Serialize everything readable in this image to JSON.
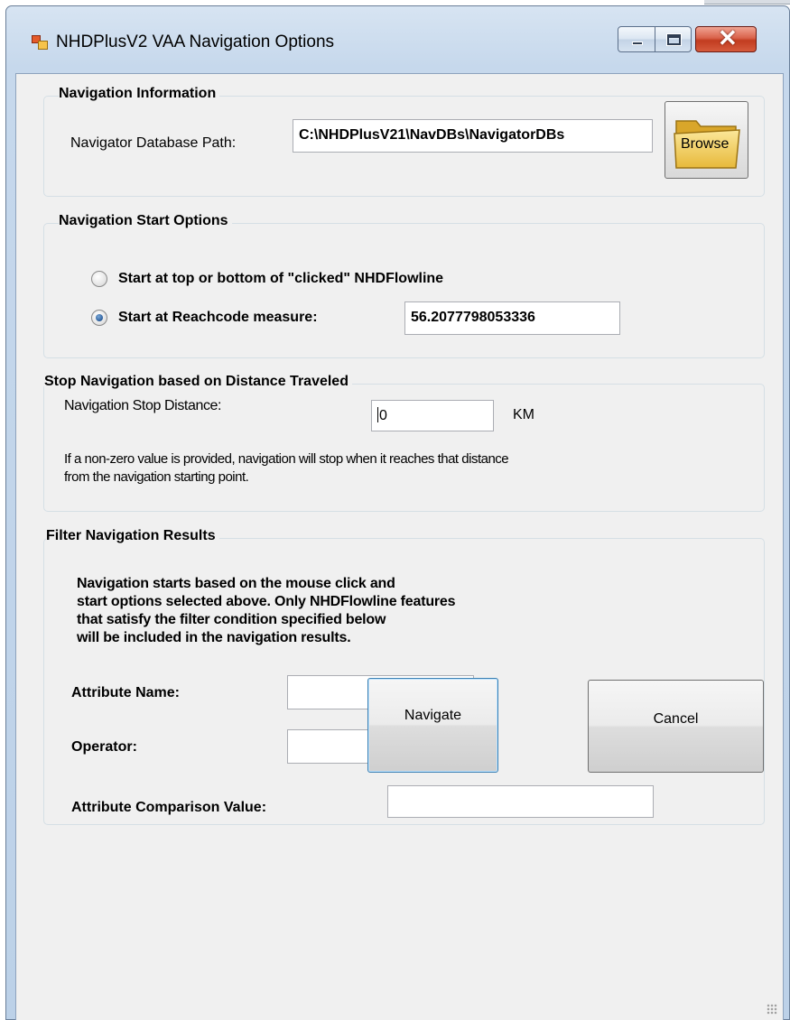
{
  "window": {
    "title": "NHDPlusV2 VAA Navigation Options"
  },
  "navigation_information": {
    "legend": "Navigation Information",
    "path_label": "Navigator Database Path:",
    "path_value": "C:\\NHDPlusV21\\NavDBs\\NavigatorDBs",
    "browse_label": "Browse",
    "browse_icon": "folder-icon"
  },
  "start_options": {
    "legend": "Navigation Start Options",
    "option_top_bottom": {
      "label": "Start at top or bottom of \"clicked\" NHDFlowline",
      "checked": false
    },
    "option_reachcode": {
      "label": "Start at Reachcode measure:",
      "checked": true
    },
    "reachcode_value": "56.2077798053336"
  },
  "stop_distance": {
    "legend": "Stop Navigation based on Distance Traveled",
    "label": "Navigation Stop Distance:",
    "value": "0",
    "unit": "KM",
    "note_line1": "If a non-zero value is provided, navigation will stop when it reaches that distance",
    "note_line2": "from the navigation starting point."
  },
  "filter": {
    "legend": "Filter Navigation Results",
    "desc_line1": "Navigation starts based on the mouse click and",
    "desc_line2": "start options selected above.  Only NHDFlowline features",
    "desc_line3": "that satisfy the filter condition specified below",
    "desc_line4": "will be included in the navigation results.",
    "attribute_name_label": "Attribute Name:",
    "attribute_name_value": "",
    "operator_label": "Operator:",
    "operator_value": "",
    "comparison_label": "Attribute Comparison Value:",
    "comparison_value": ""
  },
  "buttons": {
    "navigate": "Navigate",
    "cancel": "Cancel"
  },
  "colors": {
    "title_gradient_top": "#d7e4f2",
    "close_button": "#c23c20",
    "client_background": "#f0f0f0",
    "radio_checked": "#2a5c9a"
  }
}
